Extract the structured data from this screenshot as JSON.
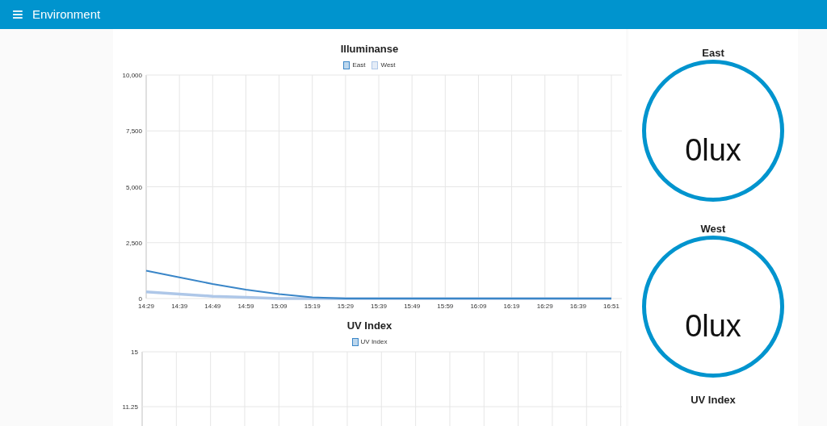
{
  "header": {
    "menu_icon": "≡",
    "title": "Environment"
  },
  "charts": [
    {
      "title": "Illuminanse",
      "chart_data": {
        "type": "line",
        "grid": true,
        "legend": "top",
        "categories": [
          "14:29",
          "14:39",
          "14:49",
          "14:59",
          "15:09",
          "15:19",
          "15:29",
          "15:39",
          "15:49",
          "15:59",
          "16:09",
          "16:19",
          "16:29",
          "16:39",
          "16:51"
        ],
        "ylim": [
          0,
          10000
        ],
        "yticks": [
          {
            "value": 0,
            "label": "0"
          },
          {
            "value": 2500,
            "label": "2,500"
          },
          {
            "value": 5000,
            "label": "5,000"
          },
          {
            "value": 7500,
            "label": "7,500"
          },
          {
            "value": 10000,
            "label": "10,000"
          }
        ],
        "series": [
          {
            "name": "East",
            "color": "#3a86c8",
            "values": [
              1250,
              950,
              650,
              400,
              200,
              50,
              0,
              0,
              0,
              0,
              0,
              0,
              0,
              0,
              0
            ]
          },
          {
            "name": "West",
            "color": "#aec7e8",
            "values": [
              300,
              200,
              100,
              50,
              0,
              0,
              0,
              0,
              0,
              0,
              0,
              0,
              0,
              0,
              0
            ]
          }
        ]
      }
    },
    {
      "title": "UV Index",
      "chart_data": {
        "type": "line",
        "grid": true,
        "legend": "top",
        "ylim": [
          0,
          15
        ],
        "yticks": [
          {
            "value": 11.25,
            "label": "11.25"
          },
          {
            "value": 15,
            "label": "15"
          }
        ],
        "series": [
          {
            "name": "UV Index",
            "color": "#3a86c8"
          }
        ]
      }
    }
  ],
  "gauges": [
    {
      "title": "East",
      "reading": "0lux"
    },
    {
      "title": "West",
      "reading": "0lux"
    },
    {
      "title": "UV Index"
    }
  ]
}
